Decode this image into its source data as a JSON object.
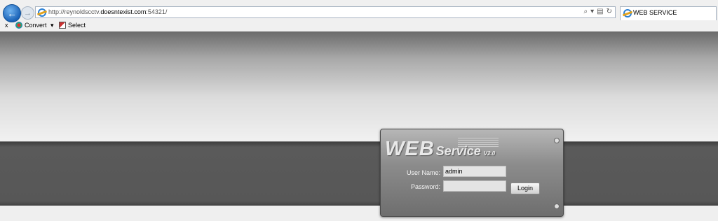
{
  "browser": {
    "address": {
      "url_plain_1": "http://reynoldscctv.",
      "url_domain": "doesntexist.com",
      "url_plain_2": ":54321/"
    },
    "address_tools": {
      "search": "⌕",
      "dropdown": "▾",
      "compat": "▤",
      "refresh": "↻"
    },
    "tab": {
      "title": "WEB SERVICE"
    },
    "command_bar": {
      "close": "x",
      "convert": "Convert",
      "dropdown": "▾",
      "select": "Select"
    }
  },
  "login": {
    "brand": {
      "web": "WEB",
      "service": "Service",
      "version": "V2.0"
    },
    "username_label": "User Name:",
    "username_value": "admin",
    "password_label": "Password:",
    "password_value": "",
    "login_button": "Login"
  },
  "colors": {
    "accent_blue": "#1b63b8"
  }
}
